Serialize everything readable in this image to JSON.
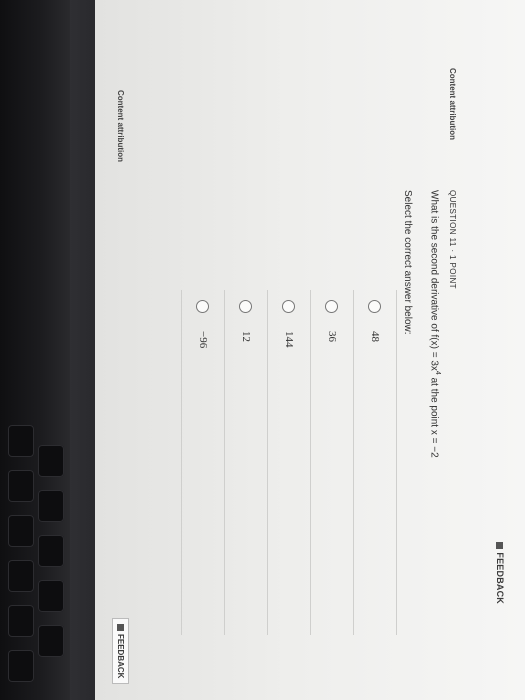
{
  "feedback_top_label": "FEEDBACK",
  "content_attribution_top": "Content attribution",
  "question": {
    "header": "QUESTION 11 · 1 POINT",
    "text_prefix": "What is the second derivative of f(x) = 3x",
    "text_exponent": "4",
    "text_suffix": " at the point x = −2",
    "instruction": "Select the correct answer below:"
  },
  "answers": [
    {
      "label": "48"
    },
    {
      "label": "36"
    },
    {
      "label": "144"
    },
    {
      "label": "12"
    },
    {
      "label": "−96"
    }
  ],
  "content_attribution_bottom": "Content attribution",
  "feedback_bottom_label": "FEEDBACK"
}
